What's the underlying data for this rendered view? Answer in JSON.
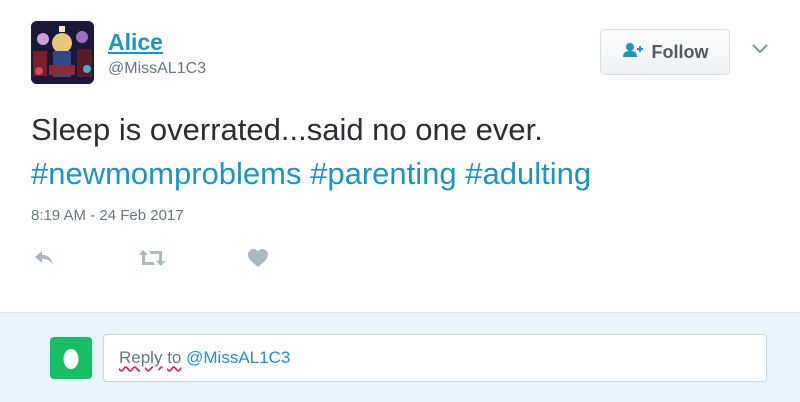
{
  "author": {
    "name": "Alice",
    "handle": "@MissAL1C3"
  },
  "follow_button": {
    "label": "Follow",
    "icon": "add-user-icon"
  },
  "tweet": {
    "text": "Sleep is overrated...said no one ever.",
    "hashtags": [
      "#newmomproblems",
      "#parenting",
      "#adulting"
    ],
    "timestamp": "8:19 AM - 24 Feb 2017"
  },
  "actions": [
    "reply-icon",
    "retweet-icon",
    "heart-icon"
  ],
  "reply_box": {
    "placeholder_word1": "Reply",
    "placeholder_word2": "to",
    "mention": "@MissAL1C3"
  },
  "colors": {
    "link": "#1b95c3",
    "reply_bar_bg": "#e8f4fb",
    "mini_avatar": "#17bf63",
    "action_icon": "#aab8c2"
  }
}
